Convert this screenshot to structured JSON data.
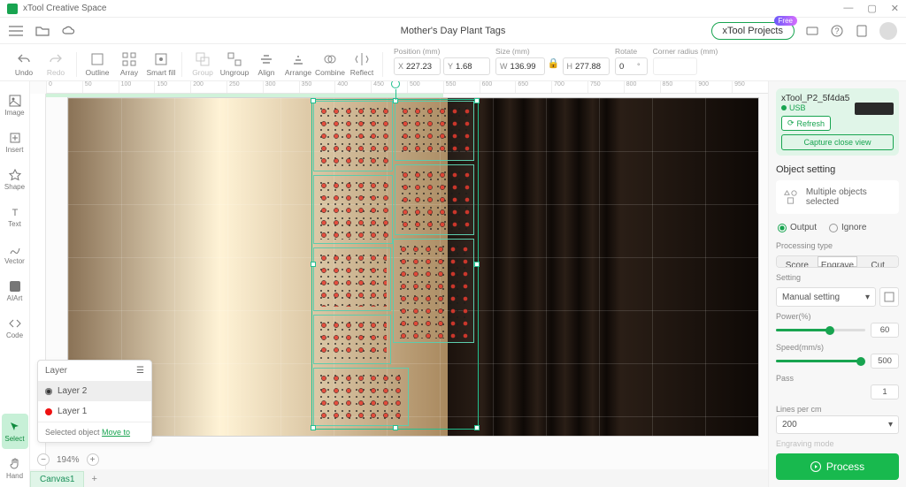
{
  "app": {
    "title": "xTool Creative Space"
  },
  "window_controls": {
    "min": "—",
    "max": "▢",
    "close": "✕"
  },
  "topbar": {
    "project_title": "Mother's Day Plant Tags",
    "xtool_projects": "xTool Projects",
    "free_badge": "Free"
  },
  "toolbar": {
    "undo": "Undo",
    "redo": "Redo",
    "outline": "Outline",
    "array": "Array",
    "smartfill": "Smart fill",
    "group": "Group",
    "ungroup": "Ungroup",
    "align": "Align",
    "arrange": "Arrange",
    "combine": "Combine",
    "reflect": "Reflect",
    "position_label": "Position (mm)",
    "x": "227.23",
    "y": "1.68",
    "size_label": "Size (mm)",
    "w": "136.99",
    "h": "277.88",
    "rotate_label": "Rotate",
    "rotate": "0",
    "corner_label": "Corner radius (mm)"
  },
  "rail": {
    "image": "Image",
    "insert": "Insert",
    "shape": "Shape",
    "text": "Text",
    "vector": "Vector",
    "aiart": "AIArt",
    "code": "Code",
    "select": "Select",
    "hand": "Hand"
  },
  "ruler": [
    "0",
    "50",
    "100",
    "150",
    "200",
    "250",
    "300",
    "350",
    "400",
    "450",
    "500",
    "550",
    "600",
    "650",
    "700",
    "750",
    "800",
    "850",
    "900",
    "950"
  ],
  "layers": {
    "title": "Layer",
    "items": [
      {
        "name": "Layer 2",
        "color": "#333333"
      },
      {
        "name": "Layer 1",
        "color": "#e11"
      }
    ],
    "footer_prefix": "Selected object ",
    "footer_link": "Move to"
  },
  "zoom": {
    "value": "194%"
  },
  "canvas_tab": "Canvas1",
  "right": {
    "device_name": "xTool_P2_5f4da5",
    "connection": "USB",
    "refresh": "Refresh",
    "capture": "Capture close view",
    "object_setting": "Object setting",
    "multi_selected": "Multiple objects selected",
    "output": "Output",
    "ignore": "Ignore",
    "processing_type": "Processing type",
    "score": "Score",
    "engrave": "Engrave",
    "cut": "Cut",
    "setting": "Setting",
    "manual_setting": "Manual setting",
    "power_label": "Power(%)",
    "power_val": "60",
    "speed_label": "Speed(mm/s)",
    "speed_val": "500",
    "pass_label": "Pass",
    "pass_val": "1",
    "lines_label": "Lines per cm",
    "lines_val": "200",
    "engraving_mode": "Engraving mode",
    "process": "Process"
  }
}
